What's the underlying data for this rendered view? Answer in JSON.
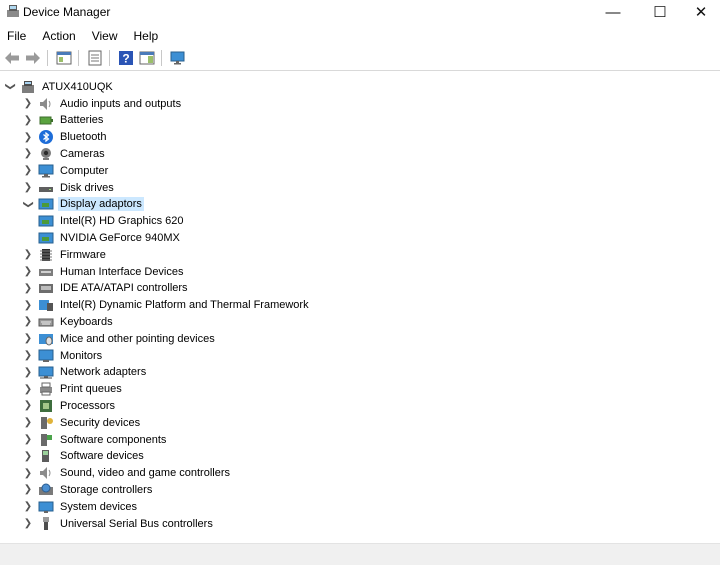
{
  "window": {
    "title": "Device Manager",
    "controls": {
      "minimize": "—",
      "maximize": "☐",
      "close": "✕"
    }
  },
  "menu": [
    "File",
    "Action",
    "View",
    "Help"
  ],
  "tree": {
    "root": "ATUX410UQK",
    "categories": [
      {
        "label": "Audio inputs and outputs",
        "icon": "speaker-icon"
      },
      {
        "label": "Batteries",
        "icon": "battery-icon"
      },
      {
        "label": "Bluetooth",
        "icon": "bluetooth-icon"
      },
      {
        "label": "Cameras",
        "icon": "camera-icon"
      },
      {
        "label": "Computer",
        "icon": "computer-icon"
      },
      {
        "label": "Disk drives",
        "icon": "disk-drive-icon"
      },
      {
        "label": "Display adaptors",
        "icon": "display-adapter-icon",
        "expanded": true,
        "selected": true,
        "children": [
          "Intel(R) HD Graphics 620",
          "NVIDIA GeForce 940MX"
        ]
      },
      {
        "label": "Firmware",
        "icon": "firmware-icon"
      },
      {
        "label": "Human Interface Devices",
        "icon": "hid-icon"
      },
      {
        "label": "IDE ATA/ATAPI controllers",
        "icon": "ide-icon"
      },
      {
        "label": "Intel(R) Dynamic Platform and Thermal Framework",
        "icon": "thermal-framework-icon"
      },
      {
        "label": "Keyboards",
        "icon": "keyboard-icon"
      },
      {
        "label": "Mice and other pointing devices",
        "icon": "mouse-icon"
      },
      {
        "label": "Monitors",
        "icon": "monitor-icon"
      },
      {
        "label": "Network adapters",
        "icon": "network-adapter-icon"
      },
      {
        "label": "Print queues",
        "icon": "printer-icon"
      },
      {
        "label": "Processors",
        "icon": "processor-icon"
      },
      {
        "label": "Security devices",
        "icon": "security-device-icon"
      },
      {
        "label": "Software components",
        "icon": "software-component-icon"
      },
      {
        "label": "Software devices",
        "icon": "software-device-icon"
      },
      {
        "label": "Sound, video and game controllers",
        "icon": "sound-icon"
      },
      {
        "label": "Storage controllers",
        "icon": "storage-controller-icon"
      },
      {
        "label": "System devices",
        "icon": "system-device-icon"
      },
      {
        "label": "Universal Serial Bus controllers",
        "icon": "usb-icon"
      }
    ]
  }
}
